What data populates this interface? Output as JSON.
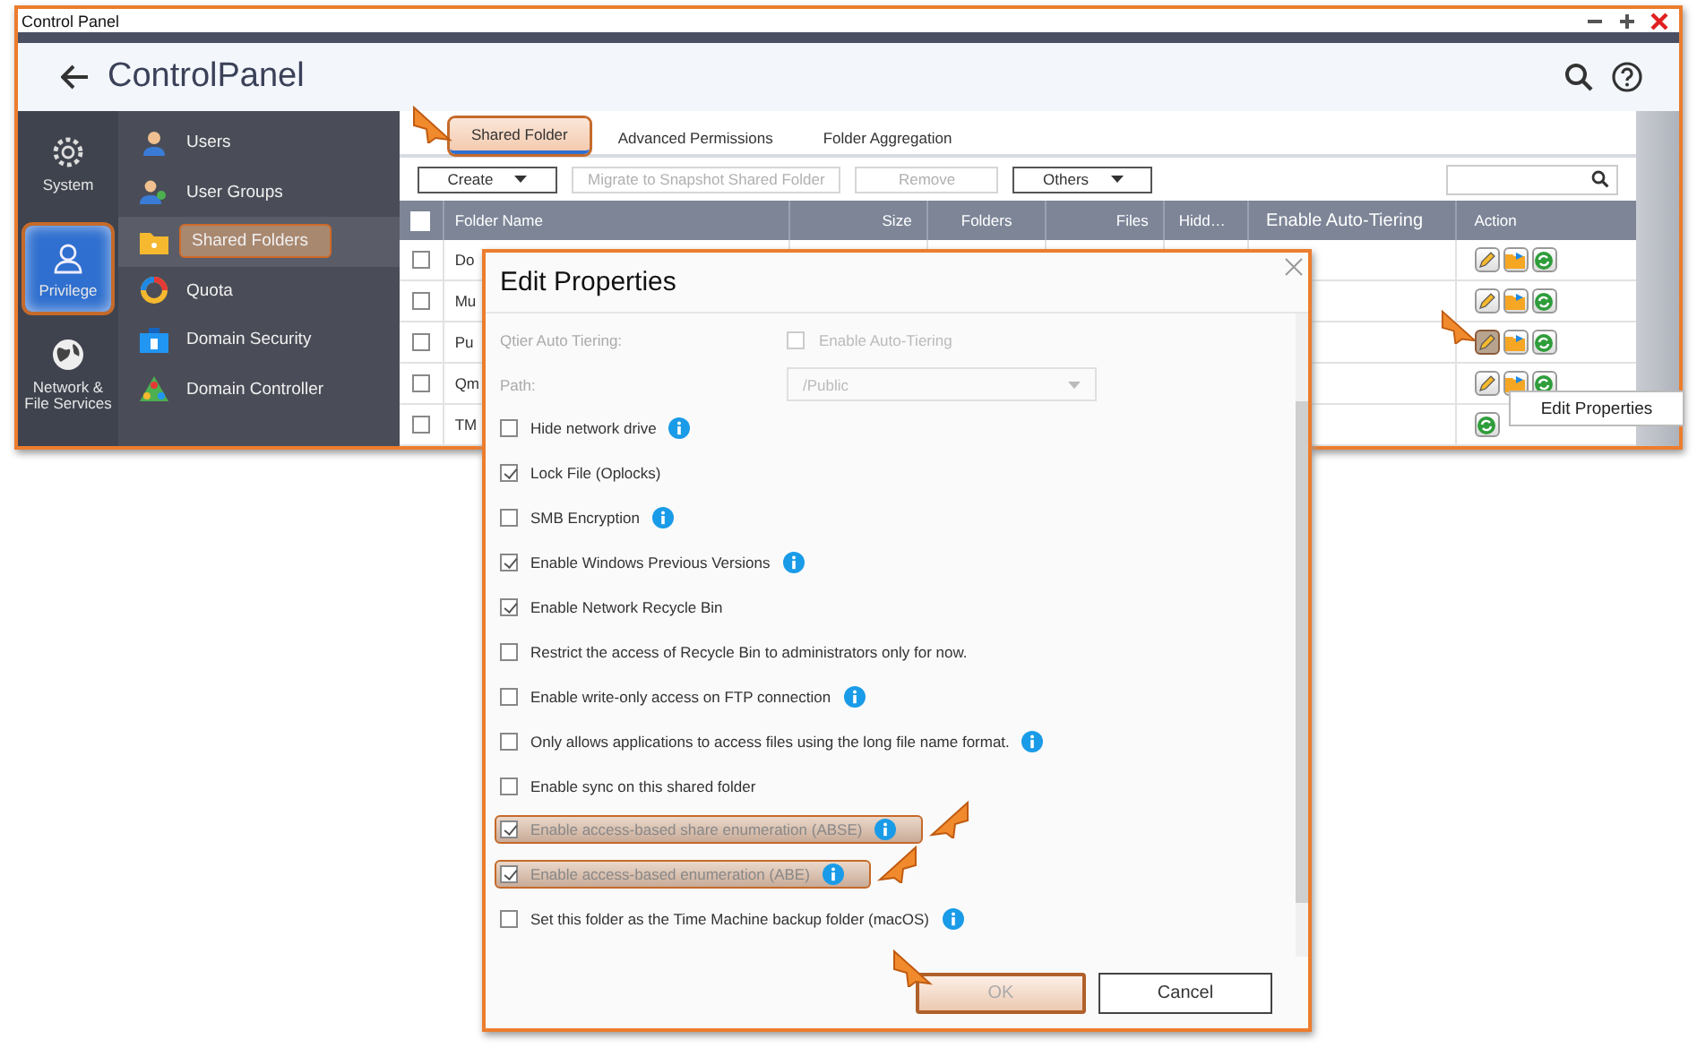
{
  "window": {
    "title": "Control Panel"
  },
  "header": {
    "title": "**Control**Panel"
  },
  "rail": [
    {
      "label": "System",
      "kind": "gear",
      "selected": false,
      "highlighted": false
    },
    {
      "label": "Privilege",
      "kind": "person",
      "selected": true,
      "highlighted": true
    },
    {
      "label": "Network & File Services",
      "kind": "globe",
      "selected": false,
      "highlighted": false
    }
  ],
  "menu": [
    {
      "label": "Users",
      "kind": "user",
      "selected": false,
      "highlighted": false
    },
    {
      "label": "User Groups",
      "kind": "group",
      "selected": false,
      "highlighted": false
    },
    {
      "label": "Shared Folders",
      "kind": "folder",
      "selected": true,
      "highlighted": true
    },
    {
      "label": "Quota",
      "kind": "quota",
      "selected": false,
      "highlighted": false
    },
    {
      "label": "Domain Security",
      "kind": "security",
      "selected": false,
      "highlighted": false
    },
    {
      "label": "Domain Controller",
      "kind": "controller",
      "selected": false,
      "highlighted": false
    }
  ],
  "tabs": [
    {
      "label": "Shared Folder",
      "selected": true,
      "highlighted": true
    },
    {
      "label": "Advanced Permissions",
      "selected": false,
      "highlighted": false
    },
    {
      "label": "Folder Aggregation",
      "selected": false,
      "highlighted": false
    }
  ],
  "toolbar": [
    {
      "label": "Create",
      "kind": "dropdown",
      "disabled": false
    },
    {
      "label": "Migrate to Snapshot Shared Folder",
      "kind": "plain",
      "disabled": true
    },
    {
      "label": "Remove",
      "kind": "plain",
      "disabled": true
    },
    {
      "label": "Others",
      "kind": "dropdown",
      "disabled": false
    }
  ],
  "table": {
    "select_all_checked": false,
    "columns": [
      "Folder Name",
      "Size",
      "Folders",
      "Files",
      "Hidd…",
      "Enable Auto-Tiering",
      "Action"
    ],
    "rows": [
      {
        "name": "Do",
        "checked": false,
        "actions": [
          {
            "kind": "edit",
            "highlighted": false
          },
          {
            "kind": "share",
            "highlighted": false
          },
          {
            "kind": "refresh",
            "highlighted": false
          }
        ]
      },
      {
        "name": "Mu",
        "checked": false,
        "actions": [
          {
            "kind": "edit",
            "highlighted": false
          },
          {
            "kind": "share",
            "highlighted": false
          },
          {
            "kind": "refresh",
            "highlighted": false
          }
        ]
      },
      {
        "name": "Pu",
        "checked": false,
        "actions": [
          {
            "kind": "edit",
            "highlighted": true
          },
          {
            "kind": "share",
            "highlighted": false
          },
          {
            "kind": "refresh",
            "highlighted": false
          }
        ]
      },
      {
        "name": "Qm",
        "checked": false,
        "actions": [
          {
            "kind": "edit",
            "highlighted": false
          },
          {
            "kind": "share",
            "highlighted": false
          },
          {
            "kind": "refresh",
            "highlighted": false
          }
        ]
      },
      {
        "name": "TM",
        "checked": false,
        "actions": [
          {
            "kind": "refresh",
            "highlighted": false
          }
        ]
      }
    ]
  },
  "tooltip": "Edit Properties",
  "dialog": {
    "title": "Edit Properties",
    "fields": [
      {
        "label": "Qtier Auto Tiering:",
        "kind": "checkbox",
        "value": "Enable Auto-Tiering",
        "checked": false
      },
      {
        "label": "Path:",
        "kind": "select",
        "value": "/Public"
      }
    ],
    "options": [
      {
        "label": "Hide network drive",
        "checked": false,
        "info": true,
        "disabled": false,
        "highlighted": false
      },
      {
        "label": "Lock File (Oplocks)",
        "checked": true,
        "info": false,
        "disabled": false,
        "highlighted": false
      },
      {
        "label": "SMB Encryption",
        "checked": false,
        "info": true,
        "disabled": false,
        "highlighted": false
      },
      {
        "label": "Enable Windows Previous Versions",
        "checked": true,
        "info": true,
        "disabled": false,
        "highlighted": false
      },
      {
        "label": "Enable Network Recycle Bin",
        "checked": true,
        "info": false,
        "disabled": false,
        "highlighted": false
      },
      {
        "label": "Restrict the access of Recycle Bin to administrators only for now.",
        "checked": false,
        "info": false,
        "disabled": false,
        "highlighted": false
      },
      {
        "label": "Enable write-only access on FTP connection",
        "checked": false,
        "info": true,
        "disabled": false,
        "highlighted": false
      },
      {
        "label": "Only allows applications to access files using the long file name format.",
        "checked": false,
        "info": true,
        "disabled": false,
        "highlighted": false
      },
      {
        "label": "Enable sync on this shared folder",
        "checked": false,
        "info": false,
        "disabled": false,
        "highlighted": false
      },
      {
        "label": "Enable access-based share enumeration (ABSE)",
        "checked": true,
        "info": true,
        "disabled": true,
        "highlighted": true
      },
      {
        "label": "Enable access-based enumeration (ABE)",
        "checked": true,
        "info": true,
        "disabled": true,
        "highlighted": true
      },
      {
        "label": "Set this folder as the Time Machine backup folder (macOS)",
        "checked": false,
        "info": true,
        "disabled": false,
        "highlighted": false
      }
    ],
    "buttons": [
      {
        "label": "OK",
        "kind": "primary",
        "disabled": true,
        "highlighted": true
      },
      {
        "label": "Cancel",
        "kind": "secondary",
        "disabled": false,
        "highlighted": false
      }
    ]
  }
}
